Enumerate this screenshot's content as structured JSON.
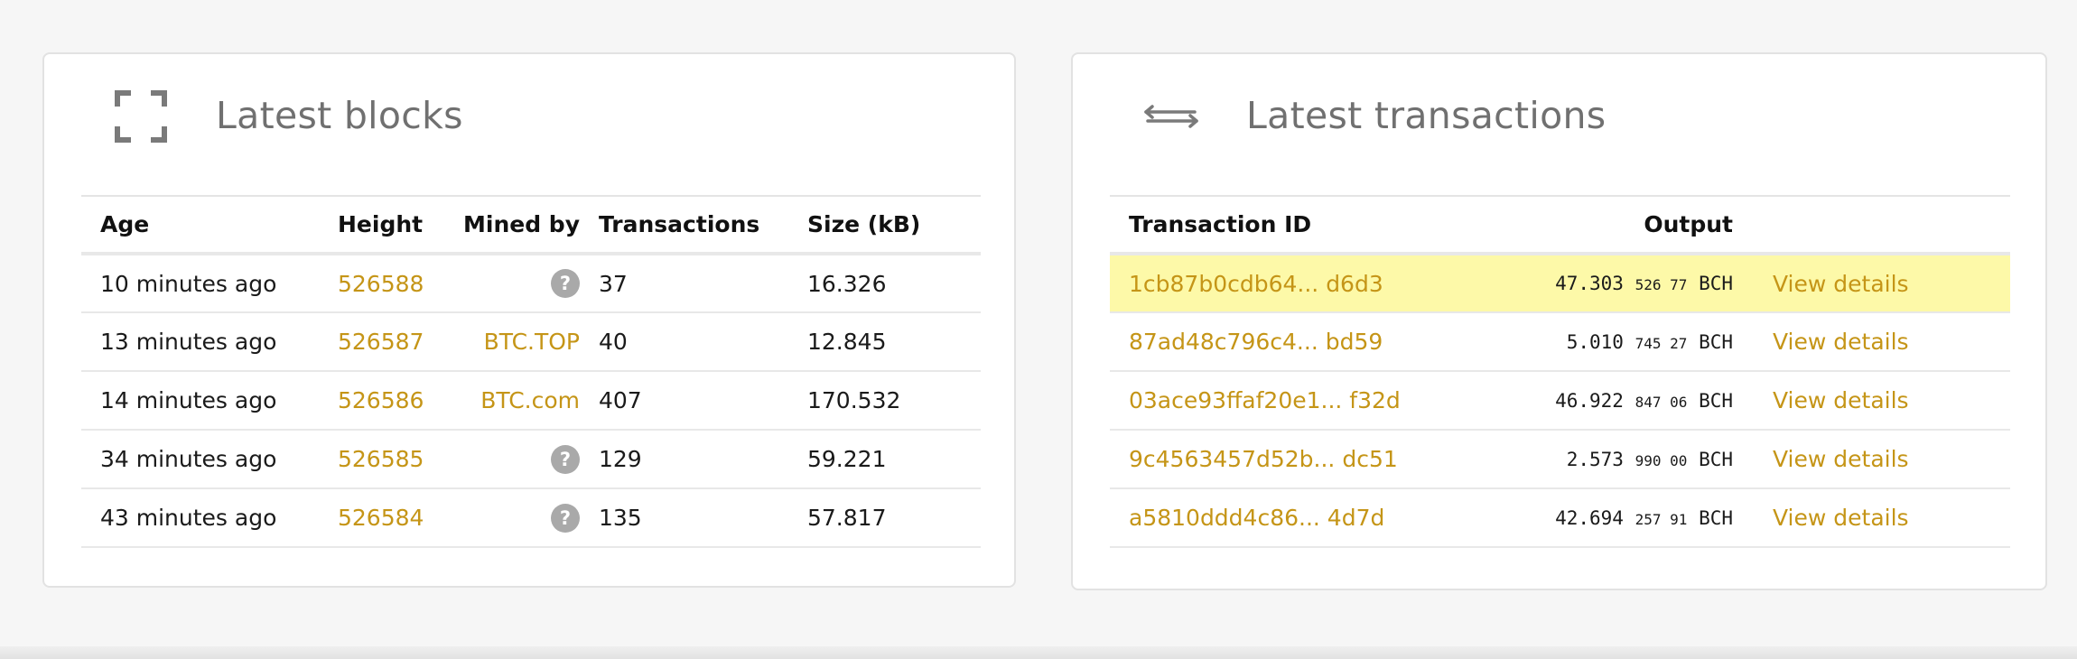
{
  "blocks": {
    "title": "Latest blocks",
    "icon": "expand-corners-icon",
    "columns": [
      "Age",
      "Height",
      "Mined by",
      "Transactions",
      "Size (kB)"
    ],
    "rows": [
      {
        "age": "10 minutes ago",
        "height": "526588",
        "miner": "?",
        "miner_unknown": true,
        "transactions": "37",
        "size": "16.326"
      },
      {
        "age": "13 minutes ago",
        "height": "526587",
        "miner": "BTC.TOP",
        "miner_unknown": false,
        "transactions": "40",
        "size": "12.845"
      },
      {
        "age": "14 minutes ago",
        "height": "526586",
        "miner": "BTC.com",
        "miner_unknown": false,
        "transactions": "407",
        "size": "170.532"
      },
      {
        "age": "34 minutes ago",
        "height": "526585",
        "miner": "?",
        "miner_unknown": true,
        "transactions": "129",
        "size": "59.221"
      },
      {
        "age": "43 minutes ago",
        "height": "526584",
        "miner": "?",
        "miner_unknown": true,
        "transactions": "135",
        "size": "57.817"
      }
    ]
  },
  "transactions": {
    "title": "Latest transactions",
    "icon": "arrows-left-right-icon",
    "columns": [
      "Transaction ID",
      "Output"
    ],
    "view_details_label": "View details",
    "rows": [
      {
        "txid": "1cb87b0cdb64... d6d3",
        "output_main": "47.303",
        "output_small": "526 77",
        "unit": "BCH",
        "highlight": true
      },
      {
        "txid": "87ad48c796c4... bd59",
        "output_main": "5.010",
        "output_small": "745 27",
        "unit": "BCH",
        "highlight": false
      },
      {
        "txid": "03ace93ffaf20e1... f32d",
        "output_main": "46.922",
        "output_small": "847 06",
        "unit": "BCH",
        "highlight": false
      },
      {
        "txid": "9c4563457d52b... dc51",
        "output_main": "2.573",
        "output_small": "990 00",
        "unit": "BCH",
        "highlight": false
      },
      {
        "txid": "a5810ddd4c86... 4d7d",
        "output_main": "42.694",
        "output_small": "257 91",
        "unit": "BCH",
        "highlight": false
      }
    ]
  },
  "colors": {
    "accent": "#c59517",
    "highlight_row": "#fdf9a8",
    "title_gray": "#707070"
  }
}
